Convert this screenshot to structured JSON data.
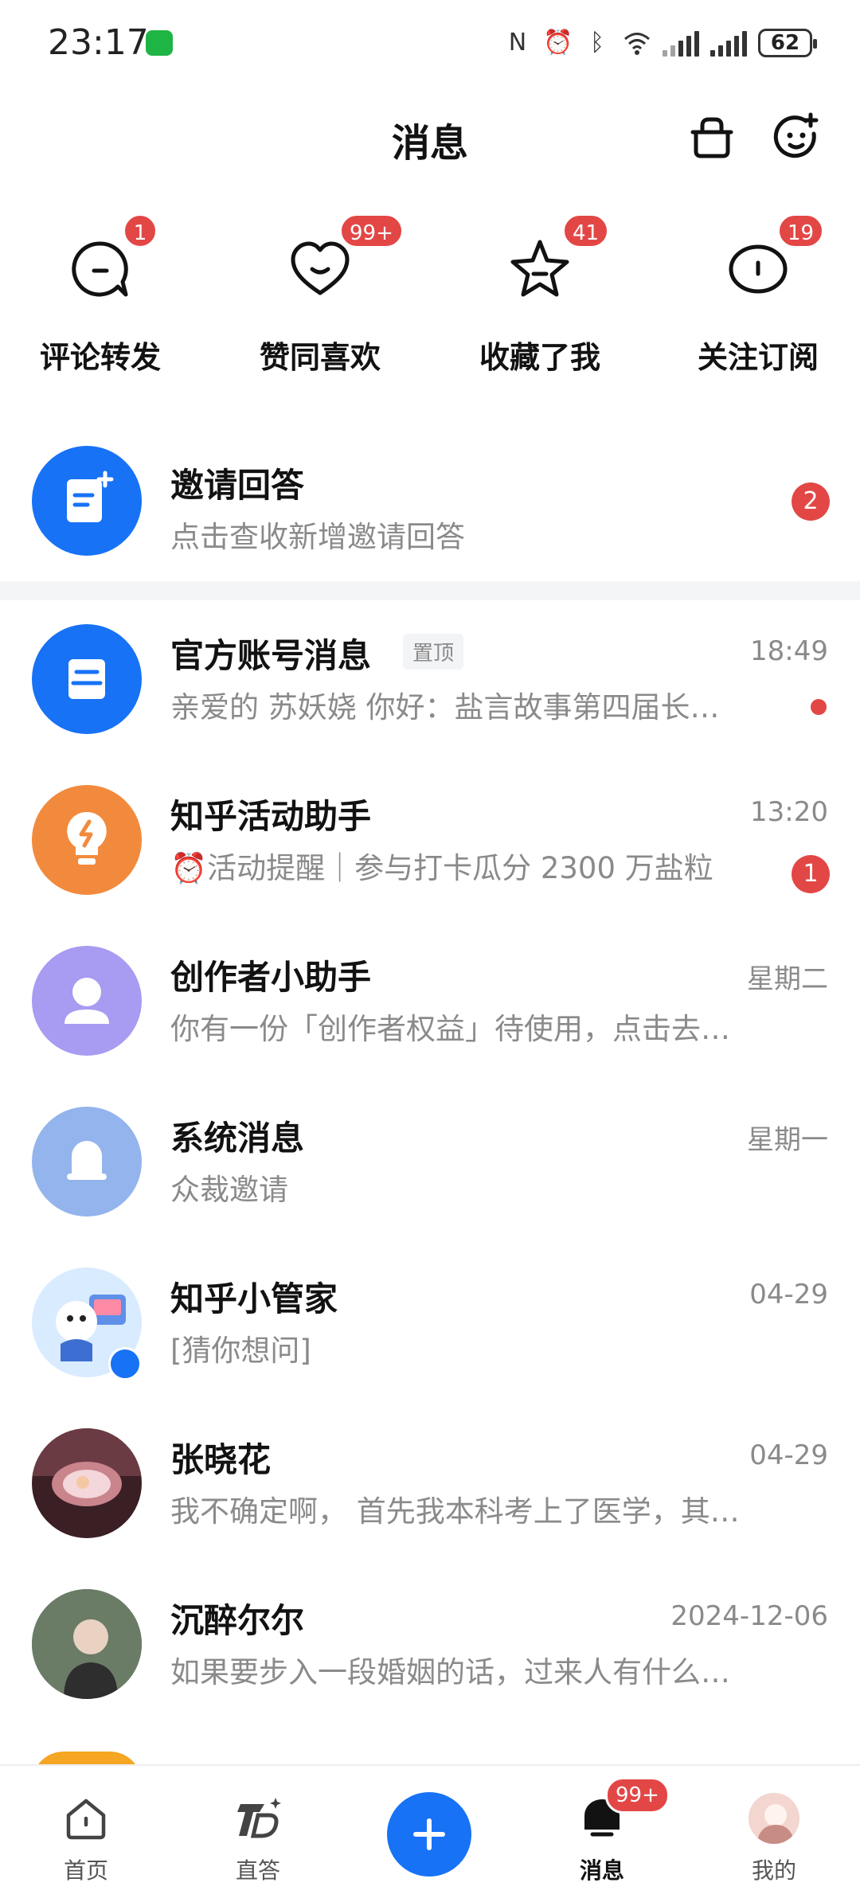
{
  "status_bar": {
    "time": "23:17",
    "battery": "62",
    "icons": [
      "wechat-icon",
      "nfc-icon",
      "alarm-icon",
      "bluetooth-icon",
      "wifi-icon",
      "signal-icon",
      "signal-icon",
      "battery-icon"
    ]
  },
  "header": {
    "title": "消息",
    "right_icons": [
      "shop-icon",
      "add-friend-icon"
    ]
  },
  "categories": [
    {
      "label": "评论转发",
      "badge": "1",
      "icon": "comment-icon"
    },
    {
      "label": "赞同喜欢",
      "badge": "99+",
      "icon": "heart-icon"
    },
    {
      "label": "收藏了我",
      "badge": "41",
      "icon": "star-icon"
    },
    {
      "label": "关注订阅",
      "badge": "19",
      "icon": "follow-icon"
    }
  ],
  "invite": {
    "title": "邀请回答",
    "subtitle": "点击查收新增邀请回答",
    "badge": "2",
    "color": "#1772f6"
  },
  "messages": [
    {
      "name": "官方账号消息",
      "tag": "置顶",
      "time": "18:49",
      "preview": "亲爱的 苏妖娆 你好：盐言故事第四届长…",
      "indicator": "dot"
    },
    {
      "name": "知乎活动助手",
      "time": "13:20",
      "preview": "⏰活动提醒｜参与打卡瓜分 2300 万盐粒",
      "badge": "1"
    },
    {
      "name": "创作者小助手",
      "time": "星期二",
      "preview": "你有一份「创作者权益」待使用，点击去…"
    },
    {
      "name": "系统消息",
      "time": "星期一",
      "preview": "众裁邀请"
    },
    {
      "name": "知乎小管家",
      "time": "04-29",
      "preview": "[猜你想问]"
    },
    {
      "name": "张晓花",
      "time": "04-29",
      "preview": "我不确定啊， 首先我本科考上了医学，其…"
    },
    {
      "name": "沉醉尔尔",
      "time": "2024-12-06",
      "preview": "如果要步入一段婚姻的话，过来人有什么…"
    }
  ],
  "bottom_nav": {
    "tabs": [
      {
        "label": "首页",
        "icon": "home-icon"
      },
      {
        "label": "直答",
        "icon": "zhida-icon"
      },
      {
        "label": "",
        "icon": "plus-icon"
      },
      {
        "label": "消息",
        "icon": "message-icon",
        "badge": "99+",
        "active": true
      },
      {
        "label": "我的",
        "icon": "profile-avatar"
      }
    ]
  },
  "colors": {
    "accent": "#1772f6",
    "badge": "#e24746",
    "orange": "#f28a3d",
    "lavender": "#a79bf2",
    "system_blue": "#93b4ec"
  }
}
